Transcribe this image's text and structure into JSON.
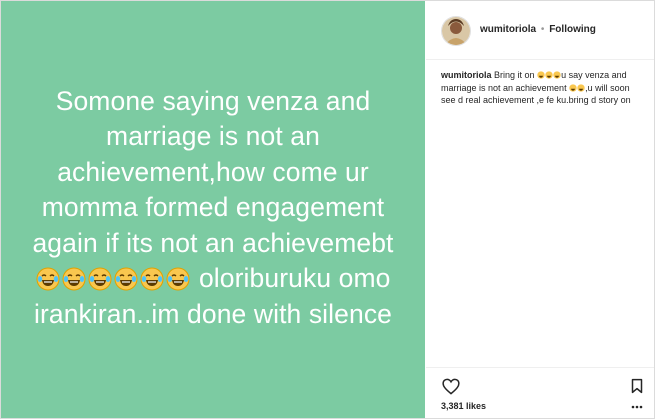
{
  "post": {
    "lines": [
      "Somone saying venza and",
      "marriage is not an",
      "achievement,how come ur",
      "momma formed engagement",
      "again if its not an achievemebt",
      "oloriburuku omo",
      "irankiran..im done with silence"
    ],
    "emoji_icon": "face-with-tears-of-joy-icon",
    "background_color": "#7ccba2"
  },
  "header": {
    "username": "wumitoriola",
    "separator": "•",
    "follow_status": "Following"
  },
  "caption": {
    "username": "wumitoriola",
    "part1": "Bring it on",
    "part2": "u say venza and marriage is not an achievement",
    "part3": ",u will soon see d real achievement ,e fe ku.bring d story on"
  },
  "actions": {
    "like_icon": "heart-icon",
    "save_icon": "bookmark-icon",
    "likes_text": "3,381 likes"
  }
}
